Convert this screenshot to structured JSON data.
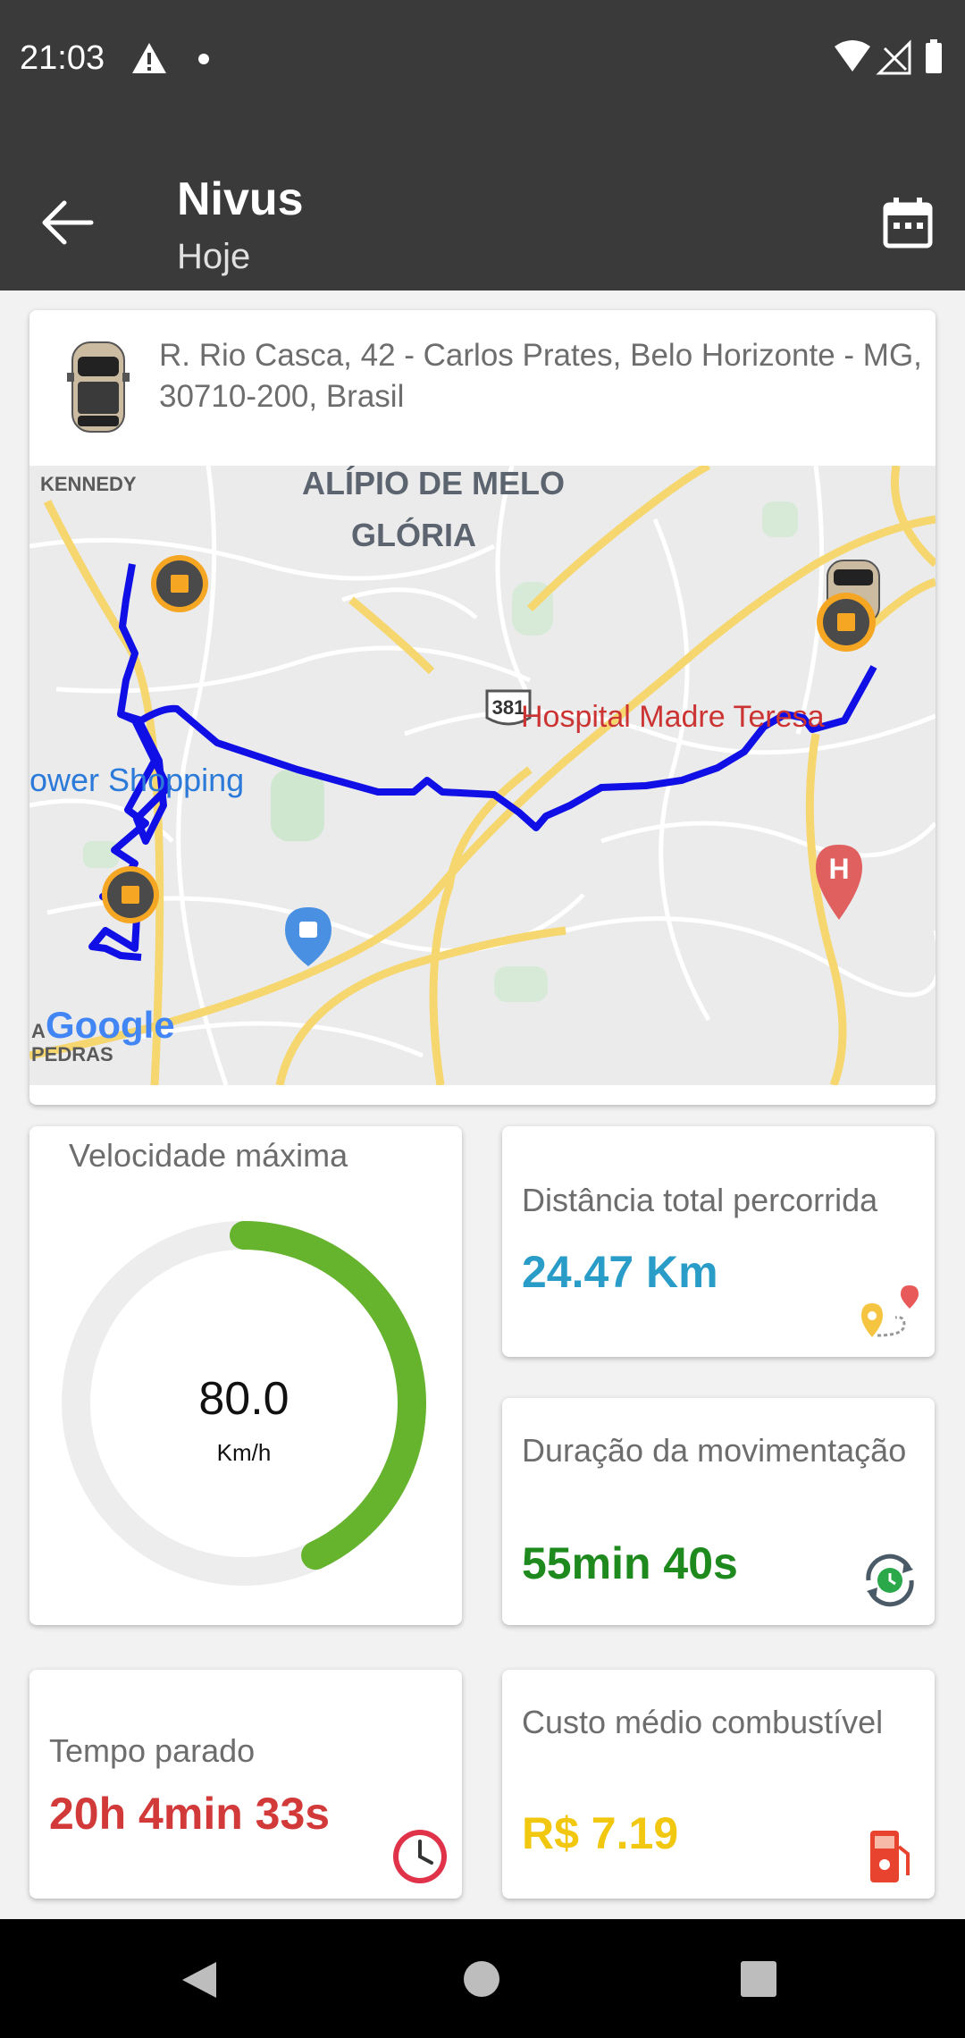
{
  "status_bar": {
    "time": "21:03"
  },
  "header": {
    "title": "Nivus",
    "subtitle": "Hoje"
  },
  "trip": {
    "address": "R. Rio Casca, 42 - Carlos Prates, Belo Horizonte - MG, 30710-200, Brasil"
  },
  "map": {
    "labels": {
      "kennedy": "KENNEDY",
      "alipio": "ALÍPIO DE MELO",
      "gloria": "GLÓRIA",
      "highway": "381",
      "hospital": "Hospital Madre Teresa",
      "hospital_marker": "H",
      "shopping": "ower Shopping",
      "pedras": "PEDRAS",
      "pedras_prefix": "A",
      "google": "Google"
    }
  },
  "speed": {
    "label": "Velocidade máxima",
    "value": "80.0",
    "unit": "Km/h",
    "fraction": 0.43,
    "color": "#66b32e"
  },
  "distance": {
    "label": "Distância total percorrida",
    "value": "24.47 Km",
    "color": "#2a9cc8"
  },
  "duration": {
    "label": "Duração da movimentação",
    "value": "55min 40s",
    "color": "#1e8a1e"
  },
  "stopped": {
    "label": "Tempo parado",
    "value": "20h 4min 33s",
    "color": "#d23a3a"
  },
  "fuel": {
    "label": "Custo médio combustível",
    "value": "R$ 7.19",
    "color": "#f1c80f"
  }
}
